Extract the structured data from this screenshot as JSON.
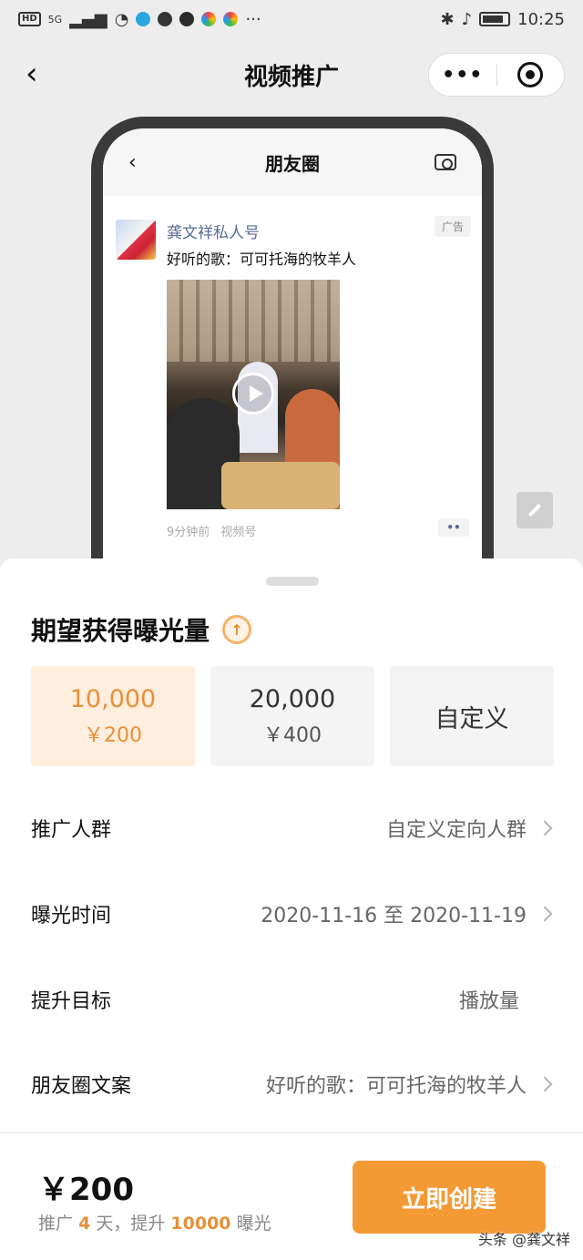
{
  "status_bar": {
    "hd": "HD",
    "signal": "5G",
    "time": "10:25",
    "more": "···"
  },
  "nav": {
    "back": "‹",
    "title": "视频推广",
    "more": "•••"
  },
  "preview": {
    "back": "‹",
    "title": "朋友圈",
    "post": {
      "name": "龚文祥私人号",
      "ad_tag": "广告",
      "text": "好听的歌：可可托海的牧羊人",
      "time": "9分钟前",
      "source": "视频号",
      "dots": "••"
    }
  },
  "sheet": {
    "title": "期望获得曝光量",
    "up_icon": "↑",
    "options": [
      {
        "amount": "10,000",
        "price": "￥200",
        "selected": true
      },
      {
        "amount": "20,000",
        "price": "￥400",
        "selected": false
      },
      {
        "label": "自定义"
      }
    ],
    "rows": [
      {
        "label": "推广人群",
        "value": "自定义定向人群"
      },
      {
        "label": "曝光时间",
        "value": "2020-11-16 至 2020-11-19"
      },
      {
        "label": "提升目标",
        "value": "播放量"
      },
      {
        "label": "朋友圈文案",
        "value": "好听的歌：可可托海的牧羊人"
      }
    ]
  },
  "footer": {
    "total": "￥200",
    "summary_pre": "推广",
    "days": "4",
    "summary_mid": "天，提升",
    "exposure": "10000",
    "summary_post": "曝光",
    "create_button": "立即创建"
  },
  "watermark": "头条 @龚文祥",
  "colors": {
    "accent": "#f39a35",
    "selected_bg": "#fdeedd",
    "link": "#576b95"
  }
}
